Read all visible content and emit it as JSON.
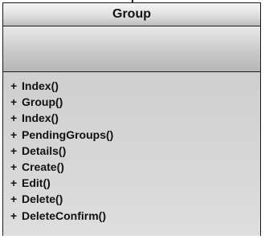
{
  "class": {
    "name": "Group",
    "operations": [
      {
        "visibility": "+",
        "label": "Index()"
      },
      {
        "visibility": "+",
        "label": "Group()"
      },
      {
        "visibility": "+",
        "label": "Index()"
      },
      {
        "visibility": "+",
        "label": "PendingGroups()"
      },
      {
        "visibility": "+",
        "label": "Details()"
      },
      {
        "visibility": "+",
        "label": "Create()"
      },
      {
        "visibility": "+",
        "label": "Edit()"
      },
      {
        "visibility": "+",
        "label": "Delete()"
      },
      {
        "visibility": "+",
        "label": "DeleteConfirm()"
      }
    ]
  }
}
